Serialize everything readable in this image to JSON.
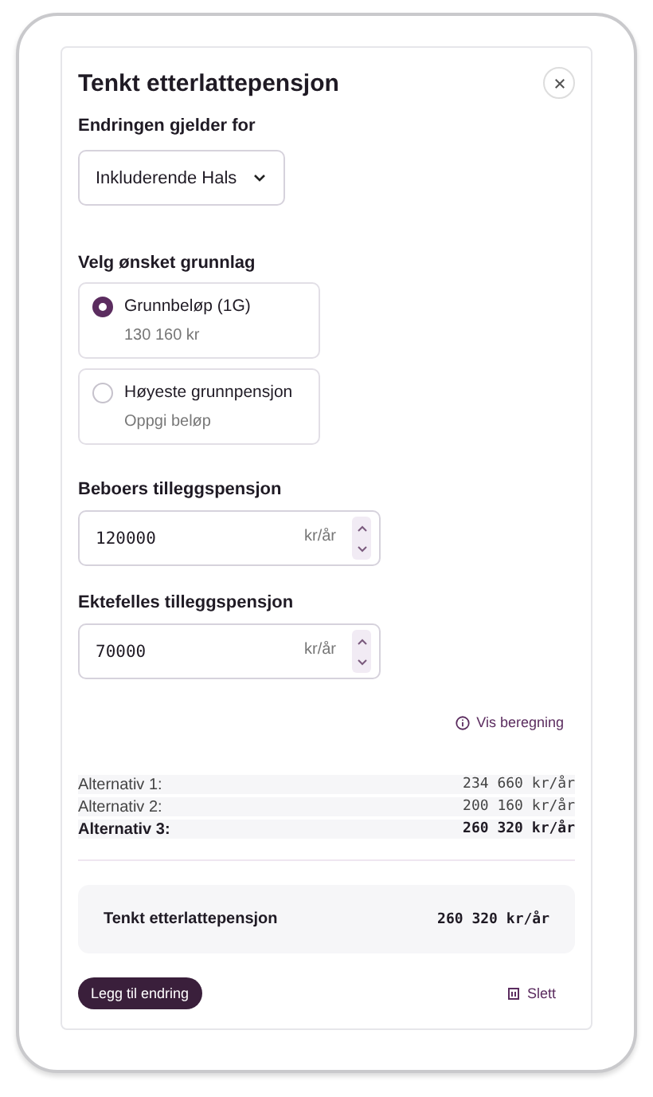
{
  "title": "Tenkt etterlattepensjon",
  "applies_to": {
    "label": "Endringen gjelder for",
    "value": "Inkluderende Hals"
  },
  "basis": {
    "label": "Velg ønsket grunnlag",
    "options": [
      {
        "label": "Grunnbeløp (1G)",
        "sublabel": "130 160 kr",
        "selected": true
      },
      {
        "label": "Høyeste grunnpensjon",
        "sublabel": "Oppgi beløp",
        "selected": false
      }
    ]
  },
  "fields": [
    {
      "label": "Beboers tilleggspensjon",
      "value": "120000",
      "unit": "kr/år"
    },
    {
      "label": "Ektefelles tilleggspensjon",
      "value": "70000",
      "unit": "kr/år"
    }
  ],
  "show_calculation_link": "Vis beregning",
  "alternatives": [
    {
      "label": "Alternativ 1:",
      "value": "234 660 kr/år",
      "highlighted": false
    },
    {
      "label": "Alternativ 2:",
      "value": "200 160 kr/år",
      "highlighted": false
    },
    {
      "label": "Alternativ 3:",
      "value": "260 320 kr/år",
      "highlighted": true
    }
  ],
  "summary": {
    "label": "Tenkt etterlattepensjon",
    "value": "260 320 kr/år"
  },
  "buttons": {
    "add": "Legg til endring",
    "delete": "Slett"
  }
}
